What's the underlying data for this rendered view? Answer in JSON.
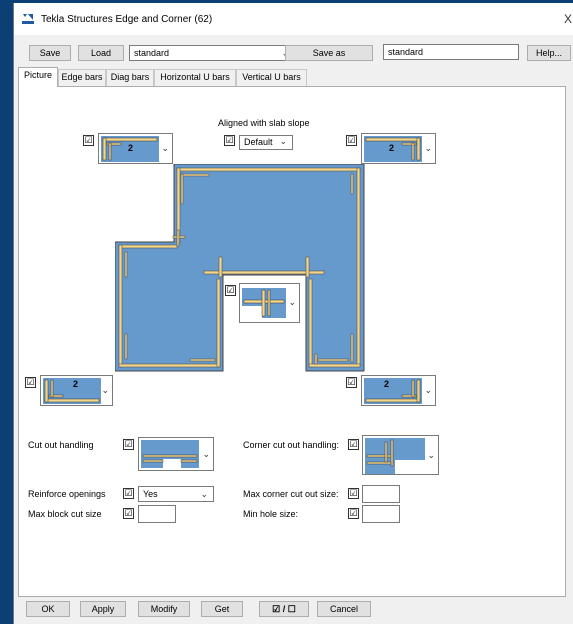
{
  "window": {
    "title": "Tekla Structures  Edge and Corner (62)",
    "close_glyph": "X"
  },
  "toolbar": {
    "save_label": "Save",
    "load_label": "Load",
    "preset_value": "standard",
    "save_as_label": "Save as",
    "save_as_value": "standard",
    "help_label": "Help..."
  },
  "tabs": [
    {
      "label": "Picture",
      "active": true
    },
    {
      "label": "Edge bars",
      "active": false
    },
    {
      "label": "Diag bars",
      "active": false
    },
    {
      "label": "Horizontal U bars",
      "active": false
    },
    {
      "label": "Vertical U bars",
      "active": false
    }
  ],
  "picture": {
    "aligned_label": "Aligned with slab slope",
    "aligned_value": "Default",
    "top_left_number": "2",
    "top_right_number": "2",
    "bottom_left_number": "2",
    "bottom_right_number": "2"
  },
  "options": {
    "cut_out_handling_label": "Cut out handling",
    "corner_cut_out_handling_label": "Corner cut out handling:",
    "reinforce_openings_label": "Reinforce openings",
    "reinforce_openings_value": "Yes",
    "max_corner_cut_out_label": "Max corner cut out size:",
    "max_block_cut_label": "Max block cut size",
    "min_hole_label": "Min hole size:"
  },
  "bottom_buttons": {
    "ok": "OK",
    "apply": "Apply",
    "modify": "Modify",
    "get": "Get",
    "toggle": "☑ / ☐",
    "cancel": "Cancel"
  },
  "colors": {
    "slab_fill": "#6699cc",
    "rebar": "#f2d48a",
    "window_bg": "#f0f0f0",
    "desktop": "#0c3f74"
  },
  "icons": {
    "checkbox_checked": "☑",
    "dropdown": "chevron-down-icon"
  }
}
